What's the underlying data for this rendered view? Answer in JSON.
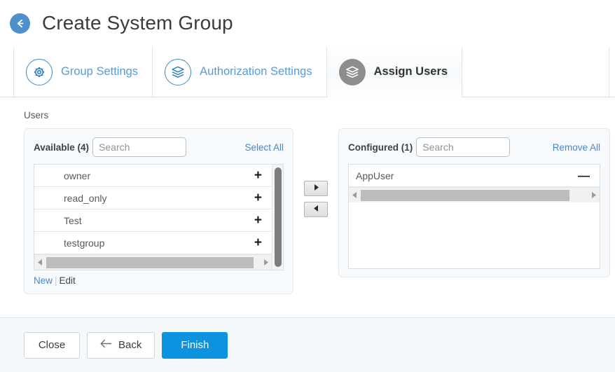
{
  "header": {
    "back_icon": "arrow-left-circle-icon",
    "title": "Create System Group"
  },
  "tabs": [
    {
      "id": "group-settings",
      "label": "Group Settings",
      "icon": "gear-icon",
      "active": false
    },
    {
      "id": "authorization-settings",
      "label": "Authorization Settings",
      "icon": "layers-stack-icon",
      "active": false
    },
    {
      "id": "assign-users",
      "label": "Assign Users",
      "icon": "layers-stack-icon",
      "active": true
    }
  ],
  "content": {
    "section_label": "Users",
    "available": {
      "count_label": "Available (4)",
      "search_placeholder": "Search",
      "search_value": "",
      "action_label": "Select All",
      "add_symbol": "+",
      "items": [
        {
          "name": "owner"
        },
        {
          "name": "read_only"
        },
        {
          "name": "Test"
        },
        {
          "name": "testgroup"
        }
      ],
      "footer": {
        "new_label": "New",
        "separator": "|",
        "edit_label": "Edit"
      }
    },
    "transfer": {
      "to_right_icon": "triangle-right-icon",
      "to_left_icon": "triangle-left-icon"
    },
    "configured": {
      "count_label": "Configured (1)",
      "search_placeholder": "Search",
      "search_value": "",
      "action_label": "Remove All",
      "remove_symbol": "—",
      "items": [
        {
          "name": "AppUser"
        }
      ]
    }
  },
  "footer": {
    "close_label": "Close",
    "back_label": "Back",
    "back_icon": "arrow-left-icon",
    "finish_label": "Finish"
  },
  "colors": {
    "accent_blue": "#0c92df",
    "link_blue": "#4a87c6",
    "tab_blue": "#5b9bd5",
    "active_tab_icon_gray": "#8d8d8d",
    "panel_bg": "#f7fafc",
    "footer_bg": "#f5f9fc"
  }
}
